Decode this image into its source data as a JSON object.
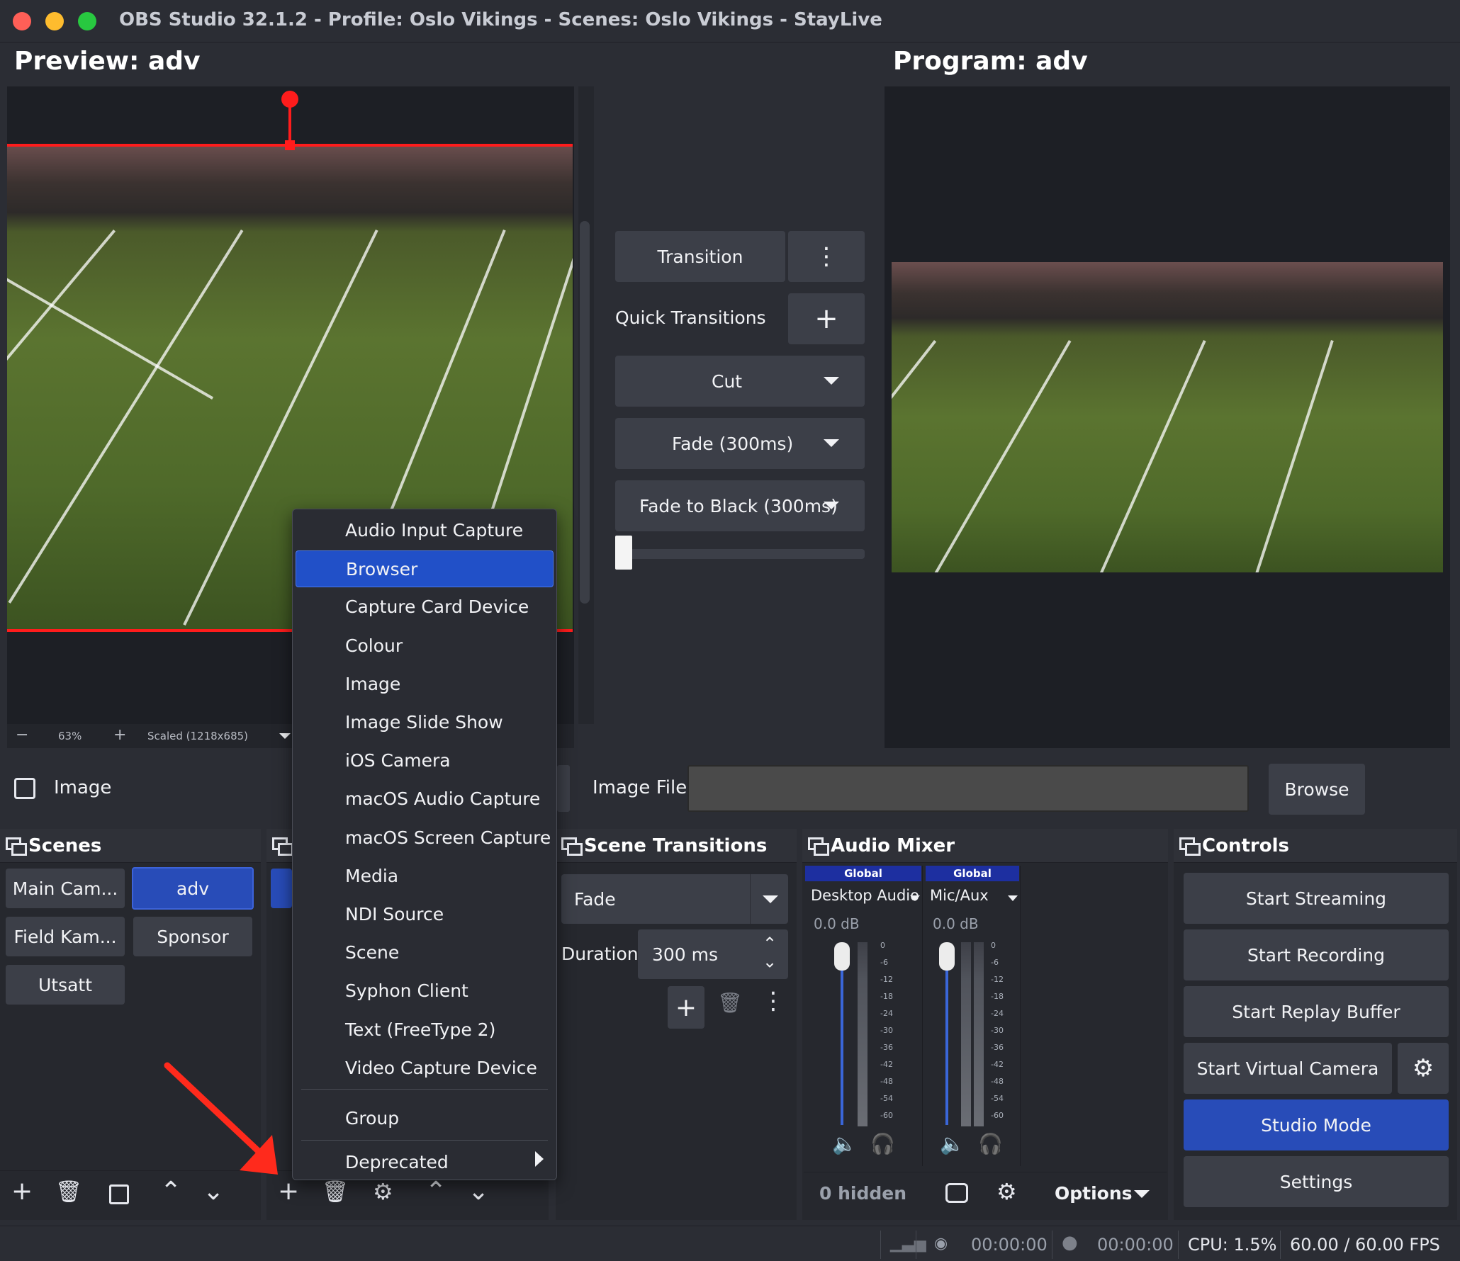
{
  "window": {
    "title": "OBS Studio 32.1.2 - Profile: Oslo Vikings - Scenes: Oslo Vikings - StayLive"
  },
  "preview": {
    "label": "Preview: adv",
    "zoom_minus": "−",
    "zoom": "63%",
    "zoom_plus": "+",
    "scale_mode": "Scaled (1218x685)"
  },
  "program": {
    "label": "Program: adv"
  },
  "transitions_panel": {
    "transition_label": "Transition",
    "more_icon": "⋮",
    "quick_transitions_label": "Quick Transitions",
    "add_icon": "+",
    "quick": [
      "Cut",
      "Fade (300ms)",
      "Fade to Black (300ms)"
    ],
    "tbar_value": 0
  },
  "source_properties": {
    "source_name": "Image",
    "image_file_label": "Image File",
    "image_file_value": "",
    "browse_label": "Browse"
  },
  "scenes": {
    "title": "Scenes",
    "items": [
      "Main Cam...",
      "adv",
      "Field Kam...",
      "Sponsor",
      "Utsatt"
    ],
    "active": "adv"
  },
  "scene_transitions": {
    "title": "Scene Transitions",
    "selected": "Fade",
    "duration_label": "Duration",
    "duration_value": "300 ms"
  },
  "audio_mixer": {
    "title": "Audio Mixer",
    "channels": [
      {
        "global_tag": "Global",
        "name": "Desktop Audio",
        "db": "0.0 dB"
      },
      {
        "global_tag": "Global",
        "name": "Mic/Aux",
        "db": "0.0 dB"
      }
    ],
    "scale": [
      "0",
      "-6",
      "-12",
      "-18",
      "-24",
      "-30",
      "-36",
      "-42",
      "-48",
      "-54",
      "-60"
    ],
    "hidden_label": "0 hidden",
    "options_label": "Options"
  },
  "controls": {
    "title": "Controls",
    "start_streaming": "Start Streaming",
    "start_recording": "Start Recording",
    "start_replay_buffer": "Start Replay Buffer",
    "start_virtual_camera": "Start Virtual Camera",
    "studio_mode": "Studio Mode",
    "settings": "Settings"
  },
  "add_source_menu": {
    "items": [
      "Audio Input Capture",
      "Browser",
      "Capture Card Device",
      "Colour",
      "Image",
      "Image Slide Show",
      "iOS Camera",
      "macOS Audio Capture",
      "macOS Screen Capture",
      "Media",
      "NDI Source",
      "Scene",
      "Syphon Client",
      "Text (FreeType 2)",
      "Video Capture Device"
    ],
    "group_label": "Group",
    "deprecated_label": "Deprecated",
    "highlighted": "Browser"
  },
  "status_bar": {
    "stream_time": "00:00:00",
    "record_time": "00:00:00",
    "cpu": "CPU: 1.5%",
    "fps": "60.00 / 60.00 FPS"
  },
  "colors": {
    "accent": "#284cb8",
    "menu_highlight": "#2150c8",
    "selection_red": "#ff1c1c",
    "annotation_arrow": "#ff2a1c"
  }
}
